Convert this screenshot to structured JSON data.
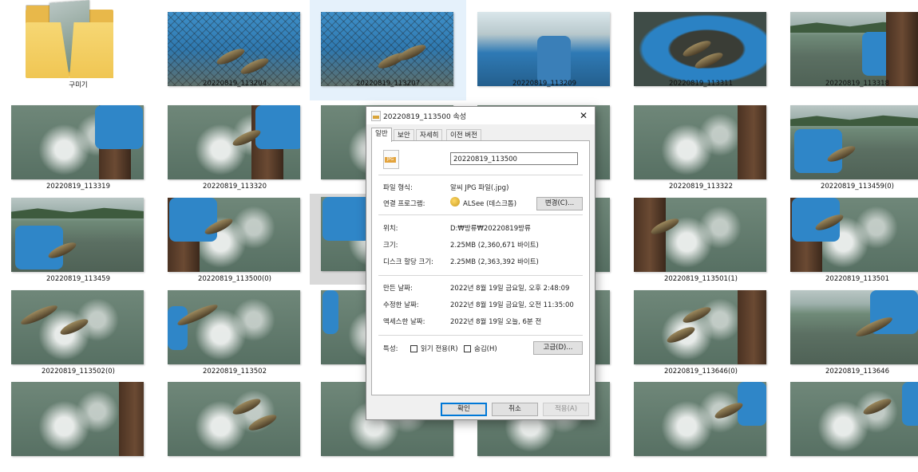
{
  "explorer": {
    "folder": {
      "label": "구미기"
    },
    "files": [
      "20220819_113204",
      "20220819_113207",
      "20220819_113209",
      "20220819_113311",
      "20220819_113318",
      "20220819_113319",
      "20220819_113320",
      "",
      "",
      "20220819_113322",
      "20220819_113459(0)",
      "20220819_113459",
      "20220819_113500(0)",
      "202",
      "",
      "20220819_113501(1)",
      "20220819_113501",
      "20220819_113502(0)",
      "20220819_113502",
      "202",
      "",
      "20220819_113646(0)",
      "20220819_113646"
    ],
    "selected": "20220819_113207"
  },
  "dialog": {
    "title": "20220819_113500 속성",
    "close_glyph": "✕",
    "tabs": [
      "일반",
      "보안",
      "자세히",
      "이전 버전"
    ],
    "active_tab": "일반",
    "file_icon_text": "JPG",
    "filename": "20220819_113500",
    "type_label": "파일 형식:",
    "type_value": "알씨 JPG 파일(.jpg)",
    "opens_label": "연결 프로그램:",
    "opens_value": "ALSee (데스크톱)",
    "change_button": "변경(C)...",
    "location_label": "위치:",
    "location_value": "D:₩방류₩20220819방류",
    "size_label": "크기:",
    "size_value": "2.25MB (2,360,671 바이트)",
    "disk_label": "디스크 할당 크기:",
    "disk_value": "2.25MB (2,363,392 바이트)",
    "created_label": "만든 날짜:",
    "created_value": "2022년 8월 19일 금요일, 오후 2:48:09",
    "modified_label": "수정한 날짜:",
    "modified_value": "2022년 8월 19일 금요일, 오전 11:35:00",
    "accessed_label": "액세스한 날짜:",
    "accessed_value": "2022년 8월 19일 오늘, 6분 전",
    "attr_label": "특성:",
    "readonly_label": "읽기 전용(R)",
    "hidden_label": "숨김(H)",
    "advanced_button": "고급(D)...",
    "ok_button": "확인",
    "cancel_button": "취소",
    "apply_button": "적용(A)"
  }
}
